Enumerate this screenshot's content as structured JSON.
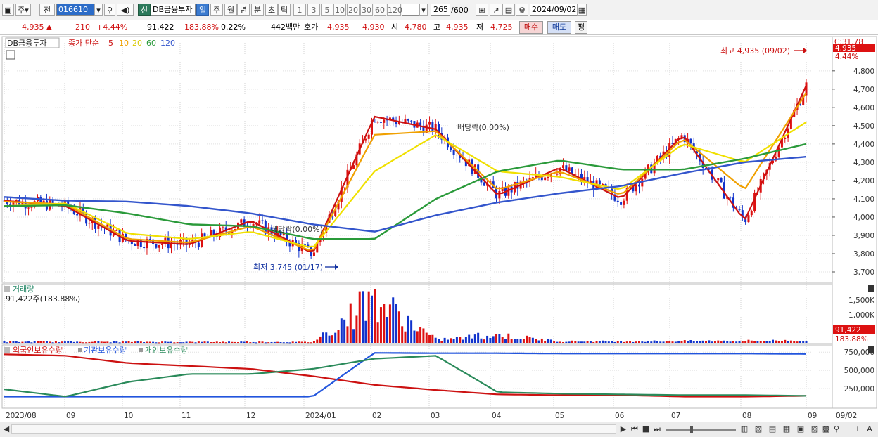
{
  "toolbar": {
    "menu_icon": "window-menu-icon",
    "type_label": "주",
    "prev_label": "전",
    "code_value": "016610",
    "search_icon": "search-icon",
    "speaker_icon": "speaker-icon",
    "new_label": "신",
    "name_value": "DB금융투자",
    "periods": [
      "일",
      "주",
      "월",
      "년",
      "분",
      "초",
      "틱"
    ],
    "active_period": "일",
    "intervals": [
      "1",
      "3",
      "5",
      "10",
      "20",
      "30",
      "60",
      "120"
    ],
    "count_value": "265",
    "count_max": "/600",
    "date_value": "2024/09/02"
  },
  "quote": {
    "price": "4,935",
    "arrow": "▲",
    "change": "210",
    "change_pct": "+4.44%",
    "volume": "91,422",
    "volume_ratio": "183.88%",
    "turnover": "0.22%",
    "amount": "442백만",
    "ask_label": "호가",
    "ask": "4,935",
    "bid": "4,930",
    "open_label": "시",
    "open": "4,780",
    "high_label": "고",
    "high": "4,935",
    "low_label": "저",
    "low": "4,725",
    "buy_label": "매수",
    "sell_label": "매도",
    "eval_label": "평"
  },
  "price_panel": {
    "name_tag": "DB금융투자",
    "legend_prefix": "종가 단순",
    "ma_labels": [
      "5",
      "10",
      "20",
      "60",
      "120"
    ],
    "ma_colors": [
      "#cc1111",
      "#f0a000",
      "#f0e000",
      "#2a9a3a",
      "#3355cc"
    ],
    "right_top": "C:31.78",
    "right_price": "4,935",
    "right_pct": "4.44%",
    "high_annot": "최고 4,935 (09/02)",
    "low_annot": "최저 3,745 (01/17)",
    "dividend1": "배당락(0.00%)",
    "dividend2": "배당락(0.00%)",
    "dividend2_display": "배당락(0.00%)"
  },
  "volume_panel": {
    "title": "거래량",
    "current": "91,422주(183.88%)",
    "right_value": "91,422",
    "right_pct": "183.88%"
  },
  "holding_panel": {
    "legend": [
      "외국인보유수량",
      "기관보유수량",
      "개인보유수량"
    ],
    "colors": [
      "#cc1111",
      "#2255dd",
      "#2a8a5a"
    ]
  },
  "x_axis": [
    "2023/08",
    "09",
    "10",
    "11",
    "12",
    "2024/01",
    "02",
    "03",
    "04",
    "05",
    "06",
    "07",
    "08",
    "09"
  ],
  "x_axis_right": "09/02",
  "chart_data": [
    {
      "type": "line",
      "title": "",
      "ylabel": "",
      "y_ticks": [
        3700,
        3800,
        3900,
        4000,
        4100,
        4200,
        4300,
        4400,
        4500,
        4600,
        4700,
        4800
      ],
      "ylim": [
        3650,
        4980
      ],
      "x": [
        "2023/08",
        "09",
        "10",
        "11",
        "12",
        "2024/01",
        "02",
        "03",
        "04",
        "05",
        "06",
        "07",
        "08",
        "09/02"
      ],
      "series": [
        {
          "name": "5",
          "values": [
            4090,
            4060,
            3870,
            3850,
            3980,
            3800,
            4550,
            4480,
            4120,
            4270,
            4100,
            4450,
            3980,
            4720
          ]
        },
        {
          "name": "10",
          "values": [
            4085,
            4070,
            3880,
            3860,
            3950,
            3810,
            4450,
            4470,
            4150,
            4250,
            4120,
            4430,
            4150,
            4680
          ]
        },
        {
          "name": "20",
          "values": [
            4060,
            4075,
            3910,
            3880,
            3920,
            3830,
            4250,
            4450,
            4250,
            4220,
            4150,
            4400,
            4300,
            4520
          ]
        },
        {
          "name": "60",
          "values": [
            4060,
            4065,
            4020,
            3960,
            3950,
            3880,
            3880,
            4100,
            4250,
            4310,
            4260,
            4260,
            4320,
            4400
          ]
        },
        {
          "name": "120",
          "values": [
            4110,
            4090,
            4085,
            4060,
            4020,
            3960,
            3920,
            4010,
            4080,
            4130,
            4170,
            4240,
            4300,
            4330
          ]
        }
      ]
    },
    {
      "type": "bar",
      "title": "",
      "y_ticks": [
        "1,000K",
        "1,500K"
      ],
      "x": [
        "2023/08",
        "09",
        "10",
        "11",
        "12",
        "2024/01",
        "02",
        "03",
        "04",
        "05",
        "06",
        "07",
        "08",
        "09/02"
      ],
      "values": [
        40,
        45,
        40,
        35,
        40,
        30,
        1700,
        120,
        300,
        60,
        60,
        70,
        80,
        91
      ]
    },
    {
      "type": "line",
      "title": "",
      "y_ticks": [
        "250,000",
        "500,000",
        "750,000"
      ],
      "x": [
        "2023/08",
        "09",
        "10",
        "11",
        "12",
        "2024/01",
        "02",
        "03",
        "04",
        "05",
        "06",
        "07",
        "08",
        "09/02"
      ],
      "series": [
        {
          "name": "외국인보유수량",
          "values": [
            720000,
            700000,
            600000,
            560000,
            520000,
            420000,
            300000,
            230000,
            170000,
            160000,
            160000,
            140000,
            140000,
            150000
          ]
        },
        {
          "name": "기관보유수량",
          "values": [
            140000,
            140000,
            140000,
            140000,
            140000,
            140000,
            740000,
            735000,
            735000,
            730000,
            730000,
            730000,
            730000,
            725000
          ]
        },
        {
          "name": "개인보유수량",
          "values": [
            240000,
            140000,
            340000,
            450000,
            450000,
            520000,
            660000,
            700000,
            200000,
            180000,
            170000,
            160000,
            160000,
            150000
          ]
        }
      ]
    }
  ]
}
